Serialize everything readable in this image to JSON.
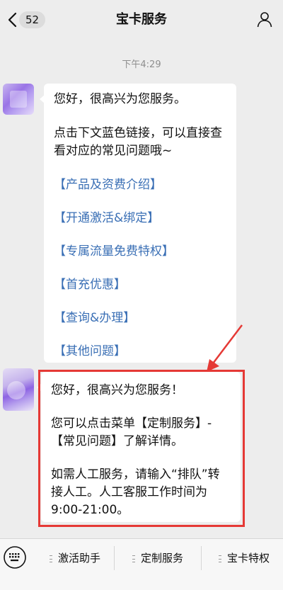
{
  "nav": {
    "badge": "52",
    "title": "宝卡服务"
  },
  "timestamp": "下午4:29",
  "message1": {
    "greeting": "您好，很高兴为您服务。",
    "intro": "点击下文蓝色链接，可以直接查看对应的常见问题哦~",
    "links": [
      "【产品及资费介绍】",
      "【开通激活&绑定】",
      "【专属流量免费特权】",
      "【首充优惠】",
      "【查询&办理】",
      "【其他问题】"
    ]
  },
  "message2": {
    "greeting": "您好，很高兴为您服务！",
    "menu_hint": "您可以点击菜单【定制服务】-【常见问题】了解详情。",
    "human_service": "如需人工服务，请输入“排队”转接人工。人工客服工作时间为9:00-21:00。"
  },
  "menu": {
    "items": [
      "激活助手",
      "定制服务",
      "宝卡特权"
    ]
  },
  "colors": {
    "link": "#3a6fb5",
    "highlight": "#e53935"
  }
}
